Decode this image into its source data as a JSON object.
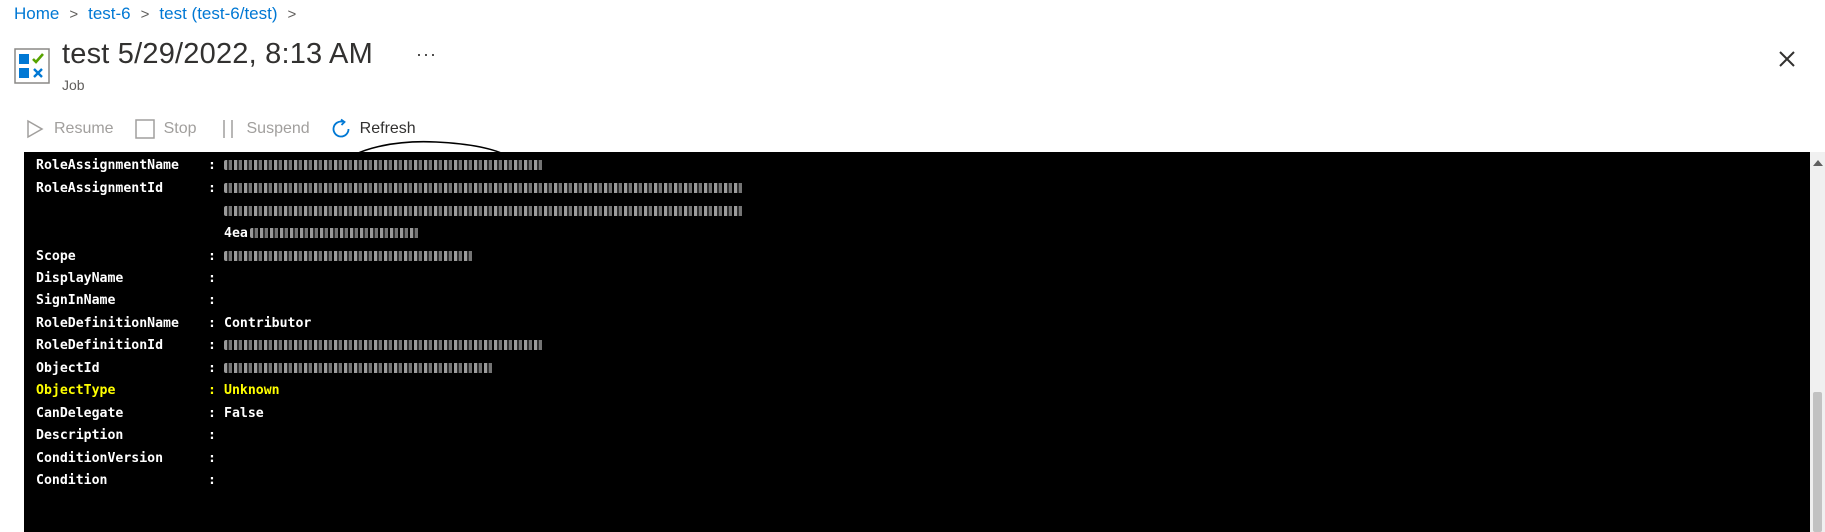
{
  "breadcrumb": [
    {
      "label": "Home"
    },
    {
      "label": "test-6"
    },
    {
      "label": "test (test-6/test)"
    }
  ],
  "header": {
    "title": "test 5/29/2022, 8:13 AM",
    "subtitle": "Job",
    "more_label": "···"
  },
  "toolbar": {
    "resume_label": "Resume",
    "stop_label": "Stop",
    "suspend_label": "Suspend",
    "refresh_label": "Refresh"
  },
  "console": {
    "rows": [
      {
        "key": "RoleAssignmentName",
        "value": ""
      },
      {
        "key": "RoleAssignmentId",
        "value": ""
      },
      {
        "key": "",
        "value": ""
      },
      {
        "key": "",
        "value": "4ea"
      },
      {
        "key": "Scope",
        "value": ""
      },
      {
        "key": "DisplayName",
        "value": ""
      },
      {
        "key": "SignInName",
        "value": ""
      },
      {
        "key": "RoleDefinitionName",
        "value": "Contributor"
      },
      {
        "key": "RoleDefinitionId",
        "value": ""
      },
      {
        "key": "ObjectId",
        "value": ""
      },
      {
        "key": "ObjectType",
        "value": "Unknown"
      },
      {
        "key": "CanDelegate",
        "value": "False"
      },
      {
        "key": "Description",
        "value": ""
      },
      {
        "key": "ConditionVersion",
        "value": ""
      },
      {
        "key": "Condition",
        "value": ""
      }
    ]
  },
  "colors": {
    "link": "#0078d4",
    "console_bg": "#000000",
    "console_text": "#ffffff",
    "highlight_text": "#ffff00"
  },
  "icons": {
    "job": "job-checklist-icon",
    "close": "close-icon",
    "resume": "play-icon",
    "stop": "stop-icon",
    "suspend": "pause-icon",
    "refresh": "refresh-icon"
  }
}
